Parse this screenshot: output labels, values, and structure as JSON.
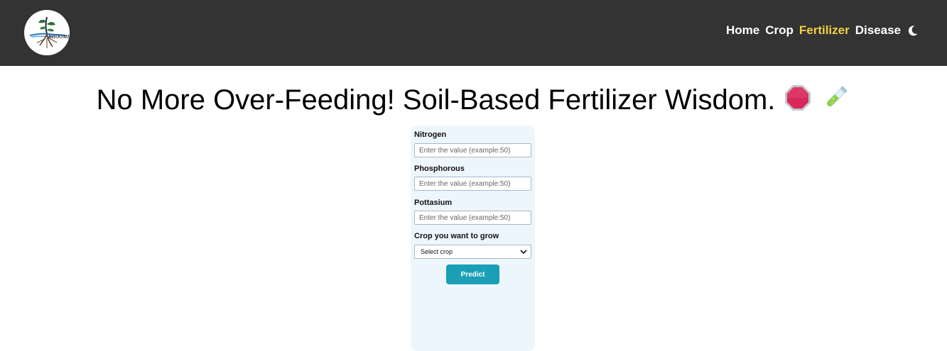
{
  "navbar": {
    "logo_text": "BHOOMI",
    "links": [
      {
        "label": "Home"
      },
      {
        "label": "Crop"
      },
      {
        "label": "Fertilizer"
      },
      {
        "label": "Disease"
      }
    ],
    "active_link": "Fertilizer",
    "theme_toggle_icon": "moon-icon"
  },
  "headline": {
    "text": "No More Over-Feeding! Soil-Based Fertilizer Wisdom.",
    "icons": [
      "stop-sign-icon",
      "test-tube-icon"
    ]
  },
  "form": {
    "nitrogen": {
      "label": "Nitrogen",
      "placeholder": "Enter the value (example:50)"
    },
    "phosphorous": {
      "label": "Phosphorous",
      "placeholder": "Enter the value (example:50)"
    },
    "pottasium": {
      "label": "Pottasium",
      "placeholder": "Enter the value (example:50)"
    },
    "crop": {
      "label": "Crop you want to grow",
      "selected": "Select crop"
    },
    "submit_label": "Predict"
  },
  "colors": {
    "navbar_bg": "#333333",
    "active_link": "#f2cf44",
    "card_bg": "#eef6fd",
    "button_bg": "#1a9fb7"
  }
}
